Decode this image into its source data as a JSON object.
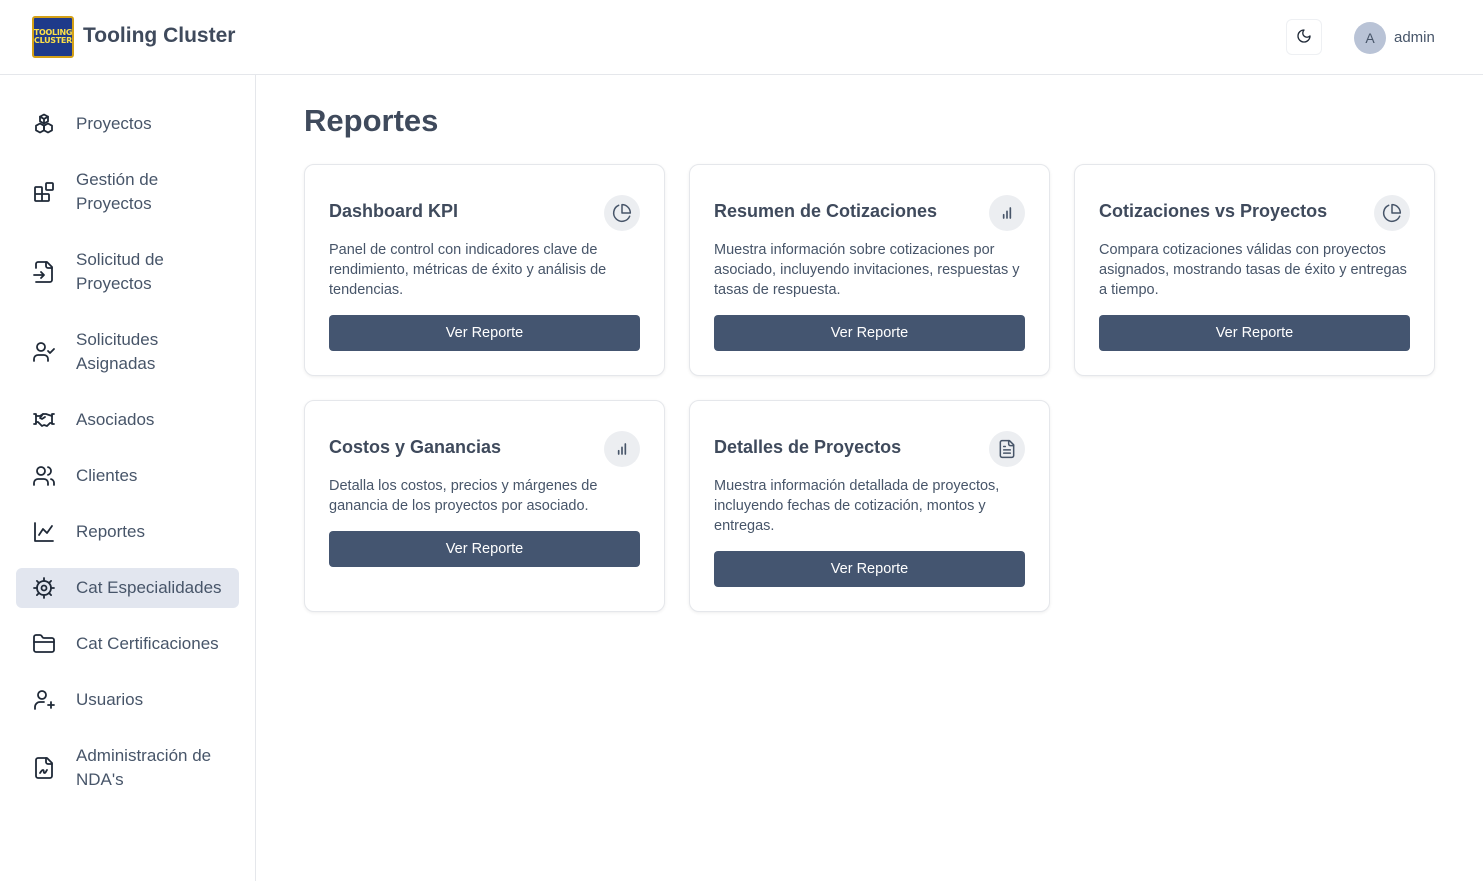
{
  "header": {
    "logo_text": [
      "TOOLING",
      "CLUSTER"
    ],
    "title": "Tooling Cluster",
    "theme_icon": "moon-icon",
    "avatar_initial": "A",
    "username": "admin"
  },
  "sidebar": {
    "items": [
      {
        "label": "Proyectos",
        "icon": "boxes-icon"
      },
      {
        "label": "Gestión de Proyectos",
        "icon": "blocks-icon"
      },
      {
        "label": "Solicitud de Proyectos",
        "icon": "file-input-icon"
      },
      {
        "label": "Solicitudes Asignadas",
        "icon": "user-check-icon"
      },
      {
        "label": "Asociados",
        "icon": "handshake-icon"
      },
      {
        "label": "Clientes",
        "icon": "users-icon"
      },
      {
        "label": "Reportes",
        "icon": "line-chart-icon"
      },
      {
        "label": "Cat Especialidades",
        "icon": "cog-icon",
        "active": true
      },
      {
        "label": "Cat Certificaciones",
        "icon": "folder-icon"
      },
      {
        "label": "Usuarios",
        "icon": "user-plus-icon"
      },
      {
        "label": "Administración de NDA's",
        "icon": "file-signature-icon"
      }
    ]
  },
  "main": {
    "title": "Reportes",
    "cards": [
      {
        "title": "Dashboard KPI",
        "icon": "pie-chart-icon",
        "description": "Panel de control con indicadores clave de rendimiento, métricas de éxito y análisis de tendencias.",
        "button": "Ver Reporte"
      },
      {
        "title": "Resumen de Cotizaciones",
        "icon": "bar-chart-icon",
        "description": "Muestra información sobre cotizaciones por asociado, incluyendo invitaciones, respuestas y tasas de respuesta.",
        "button": "Ver Reporte"
      },
      {
        "title": "Cotizaciones vs Proyectos",
        "icon": "pie-chart-icon",
        "description": "Compara cotizaciones válidas con proyectos asignados, mostrando tasas de éxito y entregas a tiempo.",
        "button": "Ver Reporte"
      },
      {
        "title": "Costos y Ganancias",
        "icon": "bar-chart-icon",
        "description": "Detalla los costos, precios y márgenes de ganancia de los proyectos por asociado.",
        "button": "Ver Reporte"
      },
      {
        "title": "Detalles de Proyectos",
        "icon": "file-text-icon",
        "description": "Muestra información detallada de proyectos, incluyendo fechas de cotización, montos y entregas.",
        "button": "Ver Reporte"
      }
    ]
  }
}
